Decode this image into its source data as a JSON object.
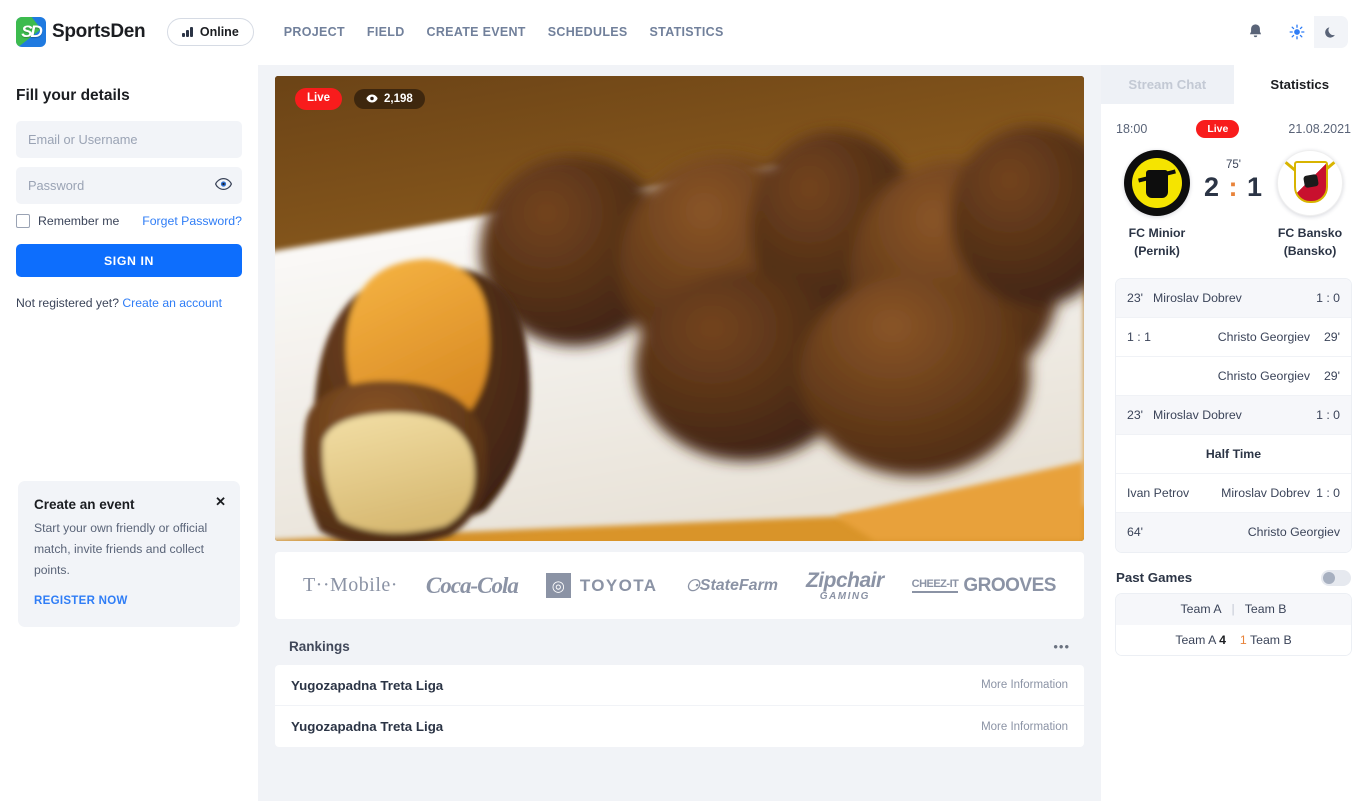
{
  "header": {
    "brand_name": "SportsDen",
    "logo_monogram": "SD",
    "status_label": "Online",
    "nav": [
      {
        "label": "PROJECT"
      },
      {
        "label": "FIELD"
      },
      {
        "label": "CREATE EVENT"
      },
      {
        "label": "SCHEDULES"
      },
      {
        "label": "STATISTICS"
      }
    ],
    "icons": {
      "bell": "bell-icon",
      "light": "sun-icon",
      "dark": "moon-icon"
    },
    "accent": "#0d6efd"
  },
  "login": {
    "title": "Fill your details",
    "email_placeholder": "Email or Username",
    "email_value": "",
    "password_placeholder": "Password",
    "password_value": "",
    "remember_label": "Remember me",
    "forgot_label": "Forget Password?",
    "signin_label": "SIGN IN",
    "not_registered": "Not registered yet?",
    "create_account": "Create an account"
  },
  "event_card": {
    "title": "Create an event",
    "body": "Start your own friendly or official match, invite friends and collect points.",
    "cta": "REGISTER NOW",
    "close": "✕"
  },
  "player": {
    "live_label": "Live",
    "views": "2,198",
    "eye_icon": "eye-icon"
  },
  "sponsors": [
    {
      "name": "T-Mobile",
      "text": "T··Mobile·"
    },
    {
      "name": "Coca-Cola",
      "text": "Coca-Cola"
    },
    {
      "name": "Toyota",
      "text": "TOYOTA"
    },
    {
      "name": "State Farm",
      "text": "StateFarm"
    },
    {
      "name": "Zipchair Gaming",
      "line1": "Zipchair",
      "line2": "GAMING"
    },
    {
      "name": "Cheez-It Grooves",
      "line1": "CHEEZ-IT",
      "line2": "GROOVES"
    }
  ],
  "rankings": {
    "title": "Rankings",
    "menu": "•••",
    "rows": [
      {
        "name": "Yugozapadna Treta Liga",
        "action": "More Information"
      },
      {
        "name": "Yugozapadna Treta Liga",
        "action": "More Information"
      }
    ]
  },
  "right_panel": {
    "tabs": [
      {
        "label": "Stream Chat",
        "active": false
      },
      {
        "label": "Statistics",
        "active": true
      }
    ],
    "match": {
      "time": "18:00",
      "live_label": "Live",
      "date": "21.08.2021",
      "minute": "75'",
      "score": "2 : 1",
      "score_home": "2",
      "score_colon": ":",
      "score_away": "1",
      "home": {
        "name": "FC Minior",
        "city": "(Pernik)"
      },
      "away": {
        "name": "FC Bansko",
        "city": "(Bansko)"
      }
    },
    "events": [
      {
        "type": "goal",
        "side": "home",
        "minute": "23'",
        "player": "Miroslav Dobrev",
        "score": "1 : 0"
      },
      {
        "type": "goal",
        "side": "away",
        "minute": "29'",
        "player": "Christo Georgiev",
        "score": "1 : 1"
      },
      {
        "type": "goal",
        "side": "away",
        "minute": "29'",
        "player": "Christo Georgiev",
        "score": ""
      },
      {
        "type": "goal",
        "side": "home",
        "minute": "23'",
        "player": "Miroslav Dobrev",
        "score": "1 : 0"
      },
      {
        "type": "halftime",
        "label": "Half Time"
      },
      {
        "type": "sub",
        "player_out": "Ivan Petrov",
        "player_in": "Miroslav Dobrev",
        "score": "1 : 0"
      },
      {
        "type": "goal",
        "side": "away",
        "minute": "64'",
        "player": "Christo Georgiev",
        "score": ""
      }
    ],
    "past_games": {
      "title": "Past Games",
      "toggle_on": false,
      "header": {
        "team_a": "Team A",
        "separator": "|",
        "team_b": "Team B"
      },
      "rows": [
        {
          "team_a": "Team A",
          "score_a": "4",
          "score_b": "1",
          "team_b": "Team B"
        }
      ]
    }
  }
}
